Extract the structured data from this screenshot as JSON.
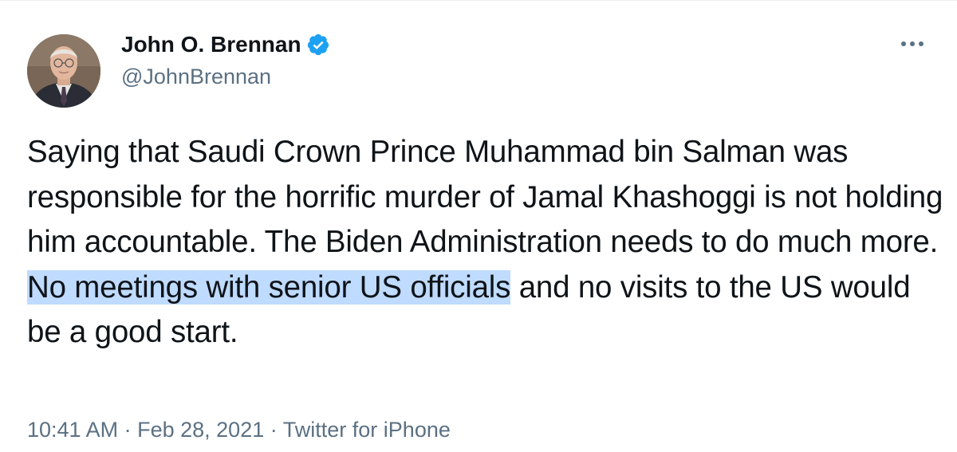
{
  "tweet": {
    "author": {
      "display_name": "John O. Brennan",
      "handle": "@JohnBrennan",
      "verified": true
    },
    "text_parts": [
      "Saying that Saudi Crown Prince Muhammad bin Salman was responsible for the horrific murder of Jamal Khashoggi is not holding him accountable. The Biden Administration needs to do much more. ",
      "No meetings with senior US officials",
      " and no visits to the US would be a good start."
    ],
    "meta": {
      "time": "10:41 AM",
      "separator": "·",
      "date": "Feb 28, 2021",
      "source": "Twitter for iPhone"
    }
  },
  "icons": {
    "verified": "verified-badge-icon",
    "more": "more-options-icon"
  },
  "colors": {
    "text": "#0f1419",
    "secondary": "#5b7083",
    "verified_blue": "#1da1f2",
    "highlight": "#bfdbff"
  }
}
